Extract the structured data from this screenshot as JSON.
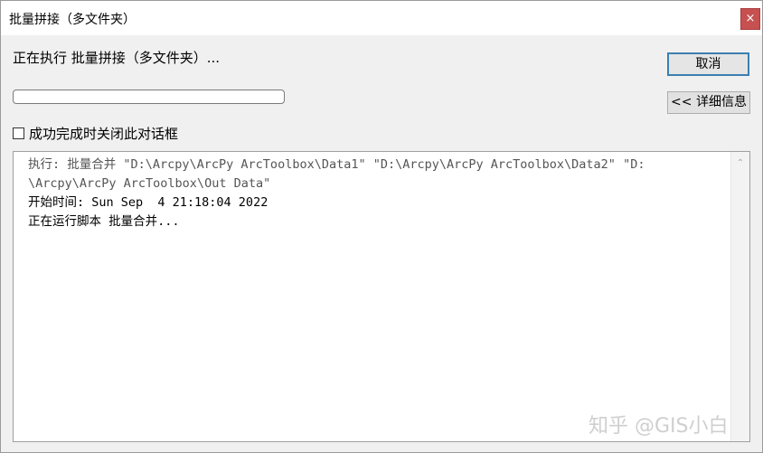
{
  "window": {
    "title": "批量拼接（多文件夹）",
    "close_glyph": "×"
  },
  "status": {
    "text": "正在执行 批量拼接（多文件夹）..."
  },
  "buttons": {
    "cancel_label": "取消",
    "details_label": "<< 详细信息"
  },
  "progress": {
    "value_percent": 0
  },
  "checkbox": {
    "label": "成功完成时关闭此对话框",
    "checked": false
  },
  "log": {
    "lines": [
      "执行: 批量合并 \"D:\\Arcpy\\ArcPy ArcToolbox\\Data1\" \"D:\\Arcpy\\ArcPy ArcToolbox\\Data2\" \"D:",
      "\\Arcpy\\ArcPy ArcToolbox\\Out Data\"",
      "开始时间: Sun Sep  4 21:18:04 2022",
      "正在运行脚本 批量合并..."
    ]
  },
  "scrollbar": {
    "up_glyph": "⌃"
  },
  "watermark": {
    "text": "知乎 @GIS小白"
  }
}
